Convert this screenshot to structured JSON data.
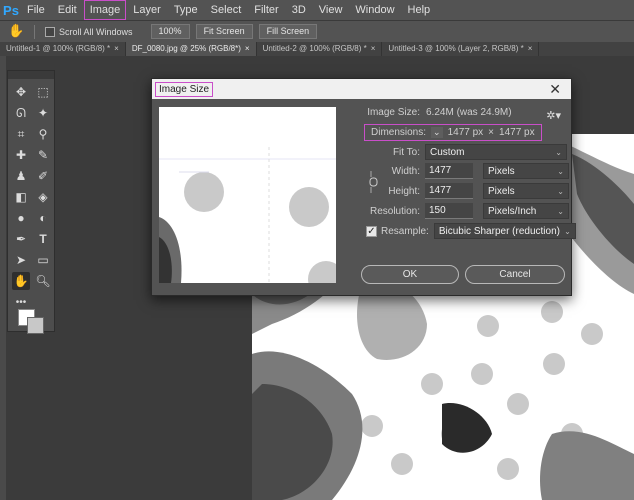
{
  "app": {
    "logo": "Ps"
  },
  "menu": [
    "File",
    "Edit",
    "Image",
    "Layer",
    "Type",
    "Select",
    "Filter",
    "3D",
    "View",
    "Window",
    "Help"
  ],
  "options_bar": {
    "scroll_all_windows": "Scroll All Windows",
    "zoom_100": "100%",
    "fit_screen": "Fit Screen",
    "fill_screen": "Fill Screen"
  },
  "tabs": [
    {
      "label": "Untitled-1 @ 100% (RGB/8) *"
    },
    {
      "label": "DF_0080.jpg @ 25% (RGB/8*)"
    },
    {
      "label": "Untitled-2 @ 100% (RGB/8) *"
    },
    {
      "label": "Untitled-3 @ 100% (Layer 2, RGB/8) *"
    }
  ],
  "dialog": {
    "title": "Image Size",
    "image_size_label": "Image Size:",
    "image_size_value": "6.24M (was 24.9M)",
    "dimensions_label": "Dimensions:",
    "dimensions_width": "1477 px",
    "dimensions_x": "×",
    "dimensions_height": "1477 px",
    "fit_to_label": "Fit To:",
    "fit_to_value": "Custom",
    "width_label": "Width:",
    "width_value": "1477",
    "width_unit": "Pixels",
    "height_label": "Height:",
    "height_value": "1477",
    "height_unit": "Pixels",
    "resolution_label": "Resolution:",
    "resolution_value": "150",
    "resolution_unit": "Pixels/Inch",
    "resample_label": "Resample:",
    "resample_value": "Bicubic Sharper (reduction)",
    "ok": "OK",
    "cancel": "Cancel"
  },
  "colors": {
    "highlight": "#c94ec9",
    "ps_blue": "#31a8ff"
  }
}
